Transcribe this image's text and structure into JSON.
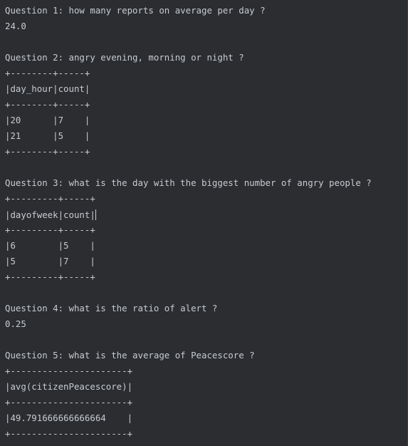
{
  "console": {
    "lines": [
      "Question 1: how many reports on average per day ?",
      "24.0",
      "",
      "Question 2: angry evening, morning or night ?",
      "+--------+-----+",
      "|day_hour|count|",
      "+--------+-----+",
      "|20      |7    |",
      "|21      |5    |",
      "+--------+-----+",
      "",
      "Question 3: what is the day with the biggest number of angry people ?",
      "+---------+-----+",
      "|dayofweek|count|",
      "+---------+-----+",
      "|6        |5    |",
      "|5        |7    |",
      "+---------+-----+",
      "",
      "Question 4: what is the ratio of alert ?",
      "0.25",
      "",
      "Question 5: what is the average of Peacescore ?",
      "+----------------------+",
      "|avg(citizenPeacescore)|",
      "+----------------------+",
      "|49.791666666666664    |",
      "+----------------------+"
    ]
  }
}
